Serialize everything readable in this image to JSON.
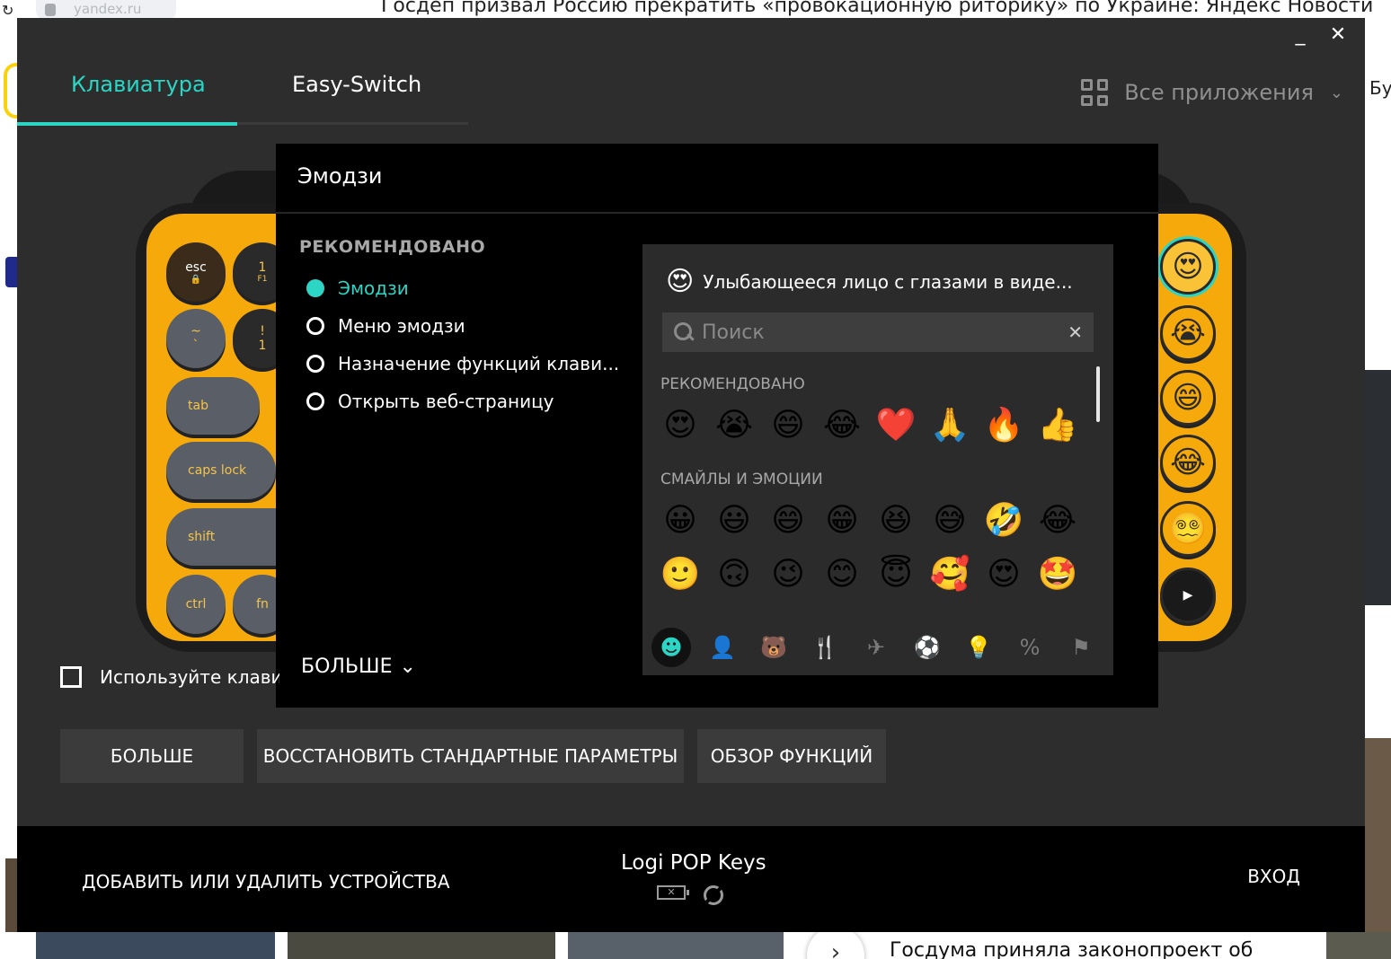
{
  "browser": {
    "url": "yandex.ru",
    "page_title": "Госдеп призвал Россию прекратить «провокационную риторику» по Украине: Яндекс Новости",
    "right_fragment_top": "Бу",
    "news_headline": "Госдума приняла законопроект об"
  },
  "app": {
    "tabs": [
      {
        "label": "Клавиатура",
        "active": true
      },
      {
        "label": "Easy-Switch",
        "active": false
      }
    ],
    "apps_select": {
      "label": "Все приложения",
      "icon": "grid-icon"
    },
    "window_controls": {
      "minimize": "_",
      "close": "✕"
    },
    "accent_color": "#2cd5c4"
  },
  "keyboard": {
    "keys_left": [
      "esc",
      "1",
      "F1",
      "~",
      "`",
      "!",
      "1",
      "tab",
      "caps lock",
      "shift",
      "ctrl",
      "fn"
    ],
    "emoji_keys": [
      "😍",
      "😭",
      "😄",
      "😂",
      "😵‍💫"
    ],
    "play_key": "▶"
  },
  "popup": {
    "title": "Эмодзи",
    "section_label": "РЕКОМЕНДОВАНО",
    "options": [
      {
        "label": "Эмодзи",
        "checked": true
      },
      {
        "label": "Меню эмодзи",
        "checked": false
      },
      {
        "label": "Назначение функций клави...",
        "checked": false
      },
      {
        "label": "Открыть веб-страницу",
        "checked": false
      }
    ],
    "more_label": "БОЛЬШЕ"
  },
  "picker": {
    "selected_emoji": "😍",
    "selected_name": "Улыбающееся лицо с глазами в виде...",
    "search_placeholder": "Поиск",
    "recommended_label": "РЕКОМЕНДОВАНО",
    "recommended": [
      "😍",
      "😭",
      "😄",
      "😂",
      "❤️",
      "🙏",
      "🔥",
      "👍"
    ],
    "smileys_label": "СМАЙЛЫ И ЭМОЦИИ",
    "smileys_row1": [
      "😀",
      "😃",
      "😄",
      "😁",
      "😆",
      "😅",
      "🤣",
      "😂"
    ],
    "smileys_row2": [
      "🙂",
      "🙃",
      "😉",
      "😊",
      "😇",
      "🥰",
      "😍",
      "🤩"
    ],
    "categories": [
      {
        "name": "smileys-icon",
        "glyph": "☻"
      },
      {
        "name": "people-icon",
        "glyph": "👤"
      },
      {
        "name": "animals-icon",
        "glyph": "🐻"
      },
      {
        "name": "food-icon",
        "glyph": "🍴"
      },
      {
        "name": "travel-icon",
        "glyph": "✈"
      },
      {
        "name": "activities-icon",
        "glyph": "⚽"
      },
      {
        "name": "objects-icon",
        "glyph": "💡"
      },
      {
        "name": "symbols-icon",
        "glyph": "%"
      },
      {
        "name": "flags-icon",
        "glyph": "⚑"
      }
    ]
  },
  "checkbox": {
    "label": "Используйте клавиши",
    "checked": false
  },
  "buttons": {
    "more": "БОЛЬШЕ",
    "restore": "ВОССТАНОВИТЬ СТАНДАРТНЫЕ ПАРАМЕТРЫ",
    "overview": "ОБЗОР ФУНКЦИЙ"
  },
  "footer": {
    "add_remove": "ДОБАВИТЬ ИЛИ УДАЛИТЬ УСТРОЙСТВА",
    "device_name": "Logi POP Keys",
    "login": "ВХОД"
  }
}
